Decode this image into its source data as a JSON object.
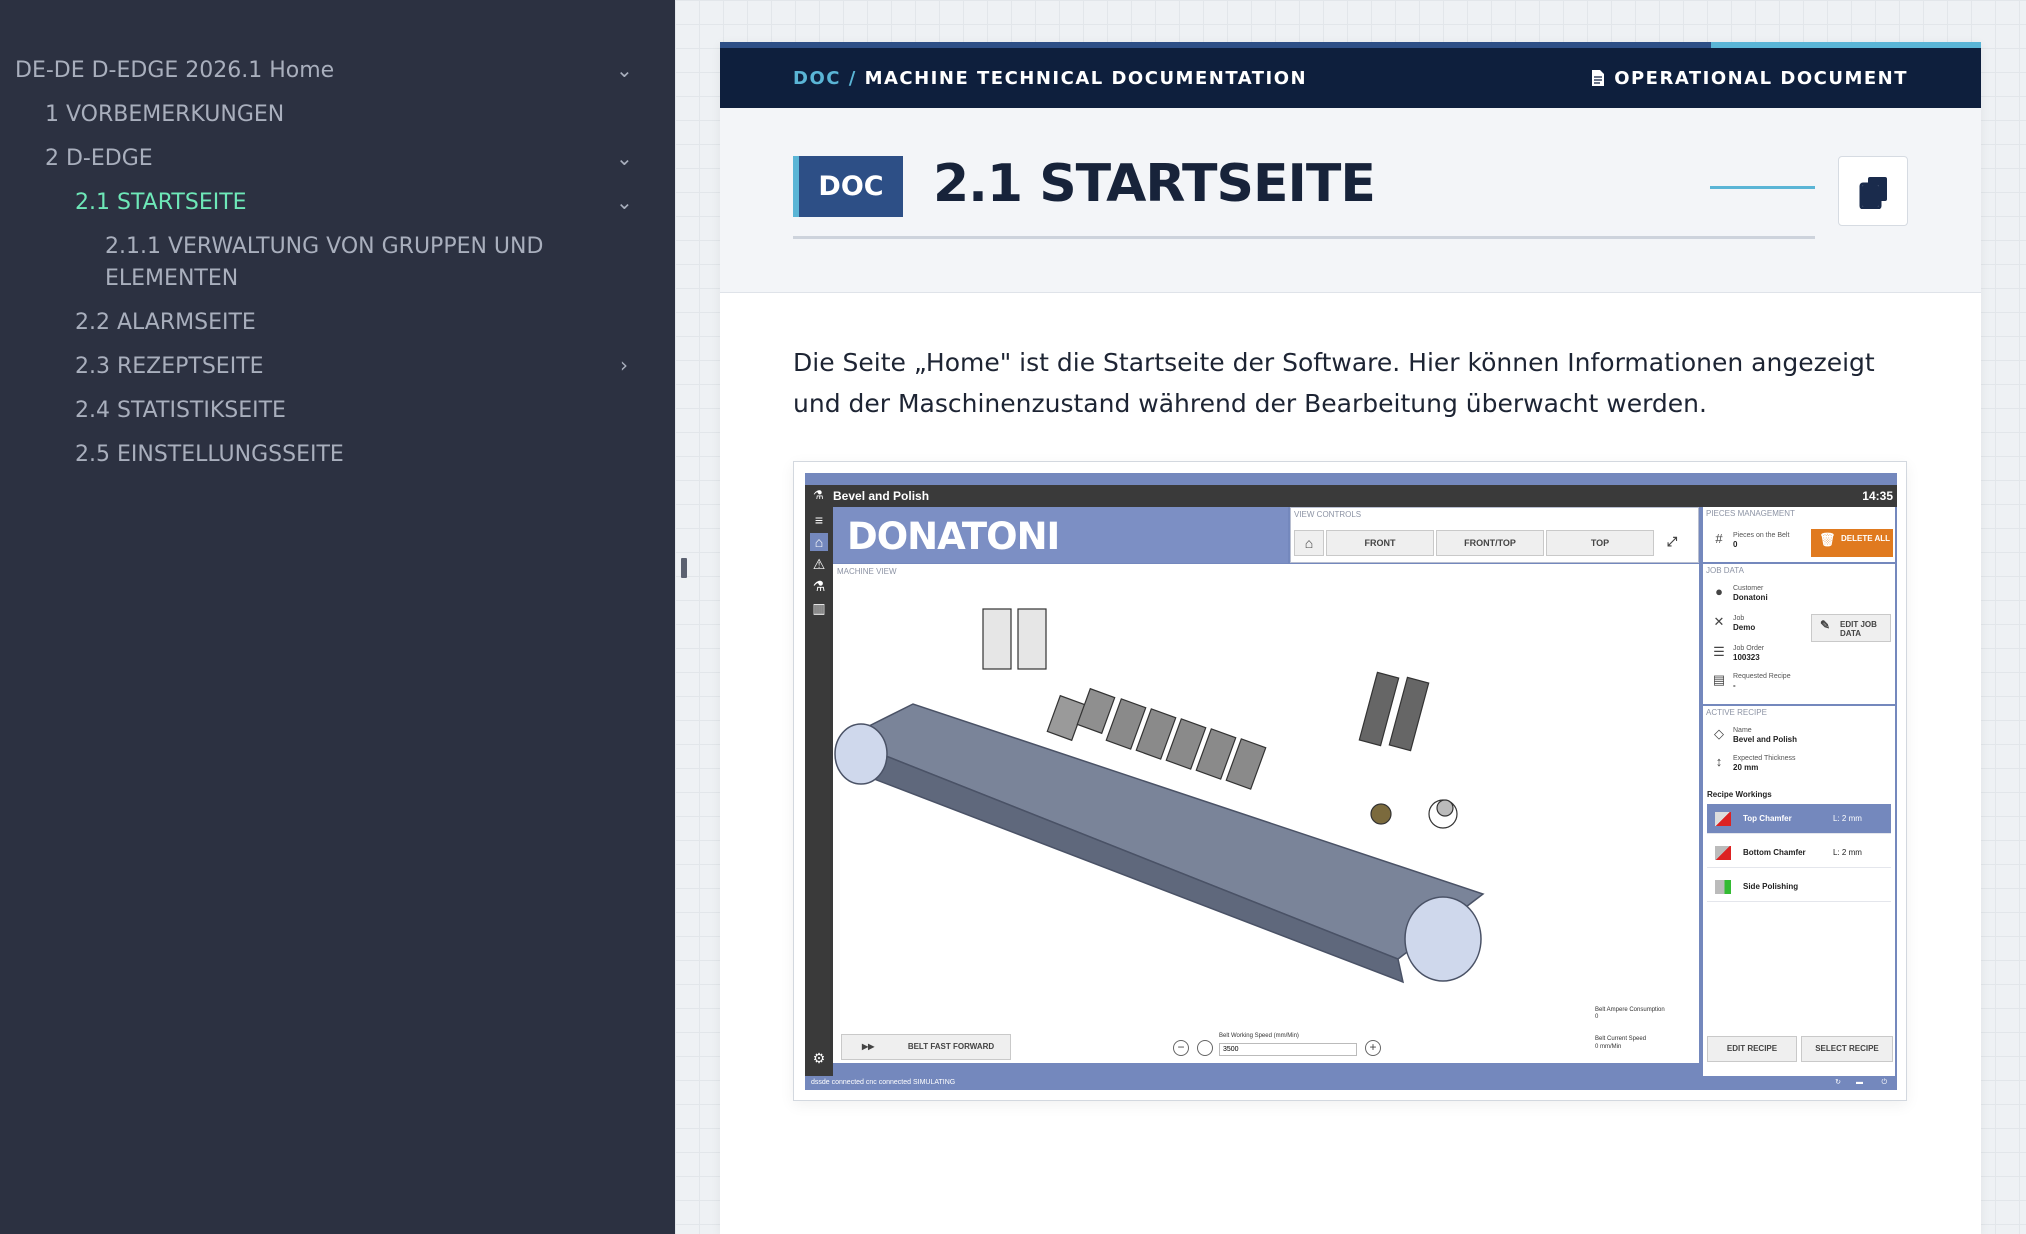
{
  "sidebar": {
    "items": [
      {
        "label": "DE-DE D-EDGE 2026.1 Home",
        "chevron": "⌄"
      },
      {
        "label": "1 VORBEMERKUNGEN"
      },
      {
        "label": "2 D-EDGE",
        "chevron": "⌄"
      },
      {
        "label": "2.1 STARTSEITE",
        "chevron": "⌄",
        "active": true
      },
      {
        "label_line1": "2.1.1 VERWALTUNG VON GRUPPEN UND",
        "label_line2": "ELEMENTEN"
      },
      {
        "label": "2.2 ALARMSEITE"
      },
      {
        "label": "2.3 REZEPTSEITE",
        "chevron": "›"
      },
      {
        "label": "2.4 STATISTIKSEITE"
      },
      {
        "label": "2.5 EINSTELLUNGSSEITE"
      }
    ]
  },
  "header": {
    "breadcrumb_doc": "DOC",
    "breadcrumb_sep": " / ",
    "breadcrumb_title": "MACHINE TECHNICAL DOCUMENTATION",
    "doc_type": "OPERATIONAL DOCUMENT",
    "doc_badge": "DOC",
    "page_title": "2.1 STARTSEITE",
    "copy_icon": "copy-icon"
  },
  "content": {
    "paragraph": "Die Seite „Home\" ist die Startseite der Software. Hier können Informationen angezeigt und der Maschinenzustand während der Bearbeitung überwacht werden."
  },
  "app_screenshot": {
    "title": "Bevel and Polish",
    "clock": "14:35",
    "logo": "DONATONI",
    "view_controls_label": "VIEW CONTROLS",
    "view_buttons": [
      "FRONT",
      "FRONT/TOP",
      "TOP"
    ],
    "machine_view_label": "MACHINE VIEW",
    "pieces_label": "PIECES MANAGEMENT",
    "pieces_on_belt_key": "Pieces on the Belt",
    "pieces_on_belt_val": "0",
    "delete_all": "DELETE ALL",
    "job_data_label": "JOB DATA",
    "customer_key": "Customer",
    "customer_val": "Donatoni",
    "job_key": "Job",
    "job_val": "Demo",
    "job_order_key": "Job Order",
    "job_order_val": "100323",
    "requested_recipe_key": "Requested Recipe",
    "requested_recipe_val": "-",
    "edit_job_data": "EDIT JOB DATA",
    "active_recipe_label": "ACTIVE RECIPE",
    "name_key": "Name",
    "name_val": "Bevel and Polish",
    "thickness_key": "Expected Thickness",
    "thickness_val": "20 mm",
    "recipe_workings_label": "Recipe Workings",
    "workings": [
      {
        "name": "Top Chamfer",
        "value": "L: 2 mm"
      },
      {
        "name": "Bottom Chamfer",
        "value": "L: 2 mm"
      },
      {
        "name": "Side Polishing",
        "value": ""
      }
    ],
    "belt_fast_forward": "BELT FAST FORWARD",
    "belt_working_speed_label": "Belt Working Speed (mm/Min)",
    "belt_working_speed_val": "3500",
    "belt_ampere_label": "Belt Ampere Consumption",
    "belt_ampere_val": "0",
    "belt_current_speed_label": "Belt Current Speed",
    "belt_current_speed_val": "0 mm/Min",
    "edit_recipe": "EDIT RECIPE",
    "select_recipe": "SELECT RECIPE",
    "status_text": "dssde connected   cnc connected SIMULATING"
  },
  "colors": {
    "sidebar_bg": "#2c3141",
    "active_nav": "#6ee8b8",
    "topbar_bg": "#0e1f3d",
    "accent": "#5ab5d6",
    "badge_bg": "#2d4f86"
  }
}
